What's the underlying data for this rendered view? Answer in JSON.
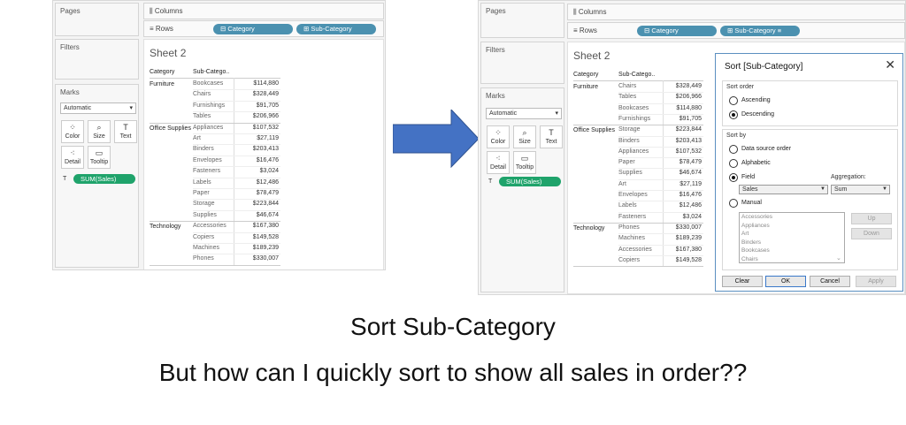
{
  "left": {
    "panels": {
      "pages": "Pages",
      "filters": "Filters",
      "marks": "Marks"
    },
    "marks_type": "Automatic",
    "mark_buttons": [
      {
        "label": "Color",
        "icon": "color-icon"
      },
      {
        "label": "Size",
        "icon": "size-icon"
      },
      {
        "label": "Text",
        "icon": "text-icon"
      },
      {
        "label": "Detail",
        "icon": "detail-icon"
      },
      {
        "label": "Tooltip",
        "icon": "tooltip-icon"
      }
    ],
    "measure_pill": "SUM(Sales)",
    "shelves": {
      "columns": "Columns",
      "rows": "Rows"
    },
    "row_pills": [
      "Category",
      "Sub-Category"
    ],
    "sheet_title": "Sheet 2",
    "headers": [
      "Category",
      "Sub-Catego.."
    ],
    "groups": [
      {
        "category": "Furniture",
        "rows": [
          [
            "Bookcases",
            "$114,880"
          ],
          [
            "Chairs",
            "$328,449"
          ],
          [
            "Furnishings",
            "$91,705"
          ],
          [
            "Tables",
            "$206,966"
          ]
        ]
      },
      {
        "category": "Office Supplies",
        "rows": [
          [
            "Appliances",
            "$107,532"
          ],
          [
            "Art",
            "$27,119"
          ],
          [
            "Binders",
            "$203,413"
          ],
          [
            "Envelopes",
            "$16,476"
          ],
          [
            "Fasteners",
            "$3,024"
          ],
          [
            "Labels",
            "$12,486"
          ],
          [
            "Paper",
            "$78,479"
          ],
          [
            "Storage",
            "$223,844"
          ],
          [
            "Supplies",
            "$46,674"
          ]
        ]
      },
      {
        "category": "Technology",
        "rows": [
          [
            "Accessories",
            "$167,380"
          ],
          [
            "Copiers",
            "$149,528"
          ],
          [
            "Machines",
            "$189,239"
          ],
          [
            "Phones",
            "$330,007"
          ]
        ]
      }
    ]
  },
  "right": {
    "panels": {
      "pages": "Pages",
      "filters": "Filters",
      "marks": "Marks"
    },
    "marks_type": "Automatic",
    "mark_buttons": [
      {
        "label": "Color",
        "icon": "color-icon"
      },
      {
        "label": "Size",
        "icon": "size-icon"
      },
      {
        "label": "Text",
        "icon": "text-icon"
      },
      {
        "label": "Detail",
        "icon": "detail-icon"
      },
      {
        "label": "Tooltip",
        "icon": "tooltip-icon"
      }
    ],
    "measure_pill": "SUM(Sales)",
    "shelves": {
      "columns": "Columns",
      "rows": "Rows"
    },
    "row_pills": [
      "Category",
      "Sub-Category"
    ],
    "sheet_title": "Sheet 2",
    "headers": [
      "Category",
      "Sub-Catego.."
    ],
    "groups": [
      {
        "category": "Furniture",
        "rows": [
          [
            "Chairs",
            "$328,449"
          ],
          [
            "Tables",
            "$206,966"
          ],
          [
            "Bookcases",
            "$114,880"
          ],
          [
            "Furnishings",
            "$91,705"
          ]
        ]
      },
      {
        "category": "Office Supplies",
        "rows": [
          [
            "Storage",
            "$223,844"
          ],
          [
            "Binders",
            "$203,413"
          ],
          [
            "Appliances",
            "$107,532"
          ],
          [
            "Paper",
            "$78,479"
          ],
          [
            "Supplies",
            "$46,674"
          ],
          [
            "Art",
            "$27,119"
          ],
          [
            "Envelopes",
            "$16,476"
          ],
          [
            "Labels",
            "$12,486"
          ],
          [
            "Fasteners",
            "$3,024"
          ]
        ]
      },
      {
        "category": "Technology",
        "rows": [
          [
            "Phones",
            "$330,007"
          ],
          [
            "Machines",
            "$189,239"
          ],
          [
            "Accessories",
            "$167,380"
          ],
          [
            "Copiers",
            "$149,528"
          ]
        ]
      }
    ]
  },
  "dialog": {
    "title": "Sort [Sub-Category]",
    "sort_order_label": "Sort order",
    "ascending": "Ascending",
    "descending": "Descending",
    "sort_by_label": "Sort by",
    "data_source_order": "Data source order",
    "alphabetic": "Alphabetic",
    "field": "Field",
    "aggregation_label": "Aggregation:",
    "field_value": "Sales",
    "aggregation_value": "Sum",
    "manual": "Manual",
    "manual_list": [
      "Accessories",
      "Appliances",
      "Art",
      "Binders",
      "Bookcases",
      "Chairs"
    ],
    "up": "Up",
    "down": "Down",
    "clear": "Clear",
    "ok": "OK",
    "cancel": "Cancel",
    "apply": "Apply"
  },
  "caption": {
    "line1": "Sort Sub-Category",
    "line2": "But how can I quickly sort to show all sales in order??"
  },
  "colors": {
    "arrow": "#4472c4",
    "pill_blue": "#4b91b0",
    "pill_green": "#1fa36b"
  }
}
